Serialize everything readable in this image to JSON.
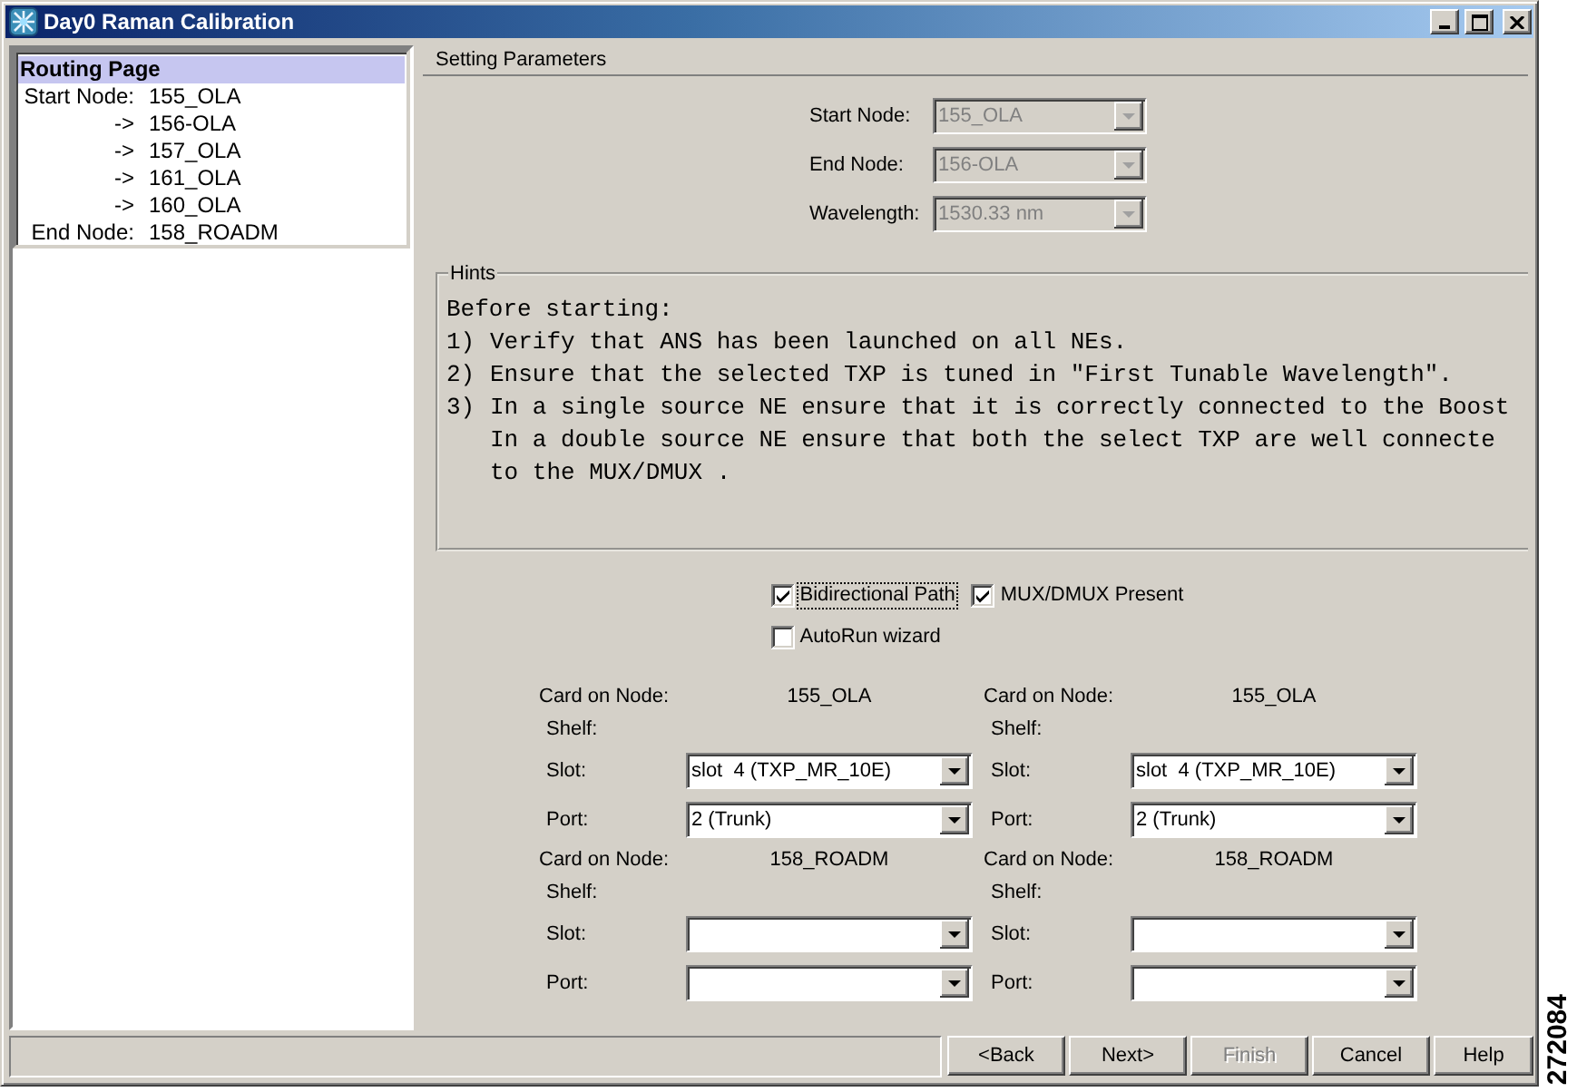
{
  "window": {
    "title": "Day0 Raman Calibration"
  },
  "routing_list": {
    "heading": "Routing Page",
    "rows": [
      {
        "label": "Start Node:",
        "node": "155_OLA"
      },
      {
        "label": "->",
        "node": "156-OLA"
      },
      {
        "label": "->",
        "node": "157_OLA"
      },
      {
        "label": "->",
        "node": "161_OLA"
      },
      {
        "label": "->",
        "node": "160_OLA"
      },
      {
        "label": "End Node:",
        "node": "158_ROADM"
      }
    ]
  },
  "settings": {
    "title": "Setting Parameters",
    "fields": [
      {
        "label": "Start Node:",
        "value": "155_OLA",
        "disabled": true
      },
      {
        "label": "End Node:",
        "value": "156-OLA",
        "disabled": true
      },
      {
        "label": "Wavelength:",
        "value": "1530.33 nm",
        "disabled": true
      }
    ]
  },
  "hints": {
    "title": "Hints",
    "intro": "Before starting:",
    "items": [
      {
        "marker": "1)",
        "lines": [
          "Verify that ANS has been launched on all NEs."
        ]
      },
      {
        "marker": "2)",
        "lines": [
          "Ensure that the selected TXP is tuned in \"First Tunable Wavelength\"."
        ]
      },
      {
        "marker": "3)",
        "lines": [
          "In a single source NE ensure that it is correctly connected to the Boost",
          "In a double source NE ensure that both the select TXP are well connecte",
          "to the MUX/DMUX ."
        ]
      }
    ]
  },
  "option_rows": [
    {
      "options": [
        {
          "label": "Bidirectional Path",
          "checked": true,
          "focused": true
        },
        {
          "label": "MUX/DMUX Present",
          "checked": true,
          "focused": false
        }
      ]
    },
    {
      "options": [
        {
          "label": "AutoRun wizard",
          "checked": false,
          "focused": false
        }
      ]
    }
  ],
  "cards": [
    {
      "columns": [
        {
          "card_label": "Card on Node:",
          "node": "155_OLA",
          "shelf_label": "Shelf:",
          "slot": {
            "label": "Slot:",
            "value": "slot  4 (TXP_MR_10E)",
            "disabled": false
          },
          "port": {
            "label": "Port:",
            "value": "2 (Trunk)",
            "disabled": false
          }
        },
        {
          "card_label": "Card on Node:",
          "node": "155_OLA",
          "shelf_label": "Shelf:",
          "slot": {
            "label": "Slot:",
            "value": "slot  4 (TXP_MR_10E)",
            "disabled": false
          },
          "port": {
            "label": "Port:",
            "value": "2 (Trunk)",
            "disabled": false
          }
        }
      ]
    },
    {
      "columns": [
        {
          "card_label": "Card on Node:",
          "node": "158_ROADM",
          "shelf_label": "Shelf:",
          "slot": {
            "label": "Slot:",
            "disabled": false
          },
          "port": {
            "label": "Port:",
            "disabled": false
          }
        },
        {
          "card_label": "Card on Node:",
          "node": "158_ROADM",
          "shelf_label": "Shelf:",
          "slot": {
            "label": "Slot:",
            "disabled": false
          },
          "port": {
            "label": "Port:",
            "disabled": false
          }
        }
      ]
    }
  ],
  "buttons": [
    {
      "label": "<Back",
      "disabled": false
    },
    {
      "label": "Next>",
      "disabled": false
    },
    {
      "label": "Finish",
      "disabled": true
    },
    {
      "label": "Cancel",
      "disabled": false
    },
    {
      "label": "Help",
      "disabled": false
    }
  ],
  "figure_number": "272084"
}
